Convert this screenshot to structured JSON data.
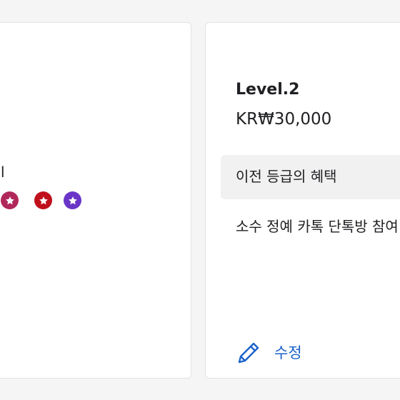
{
  "left_card": {
    "partial_text": "l",
    "badges": [
      {
        "icon": "star-icon",
        "color": "#b0285a"
      },
      {
        "icon": "star-icon",
        "color": "#c0101c"
      },
      {
        "icon": "star-icon",
        "color": "#6a35c7"
      }
    ]
  },
  "right_card": {
    "level_title": "Level.2",
    "price": "KR₩30,000",
    "benefit_label": "이전 등급의 혜택",
    "benefit_text": "소수 정예 카톡 단톡방 참여",
    "edit_label": "수정",
    "edit_icon": "pencil-icon",
    "accent_color": "#1a62c9"
  }
}
